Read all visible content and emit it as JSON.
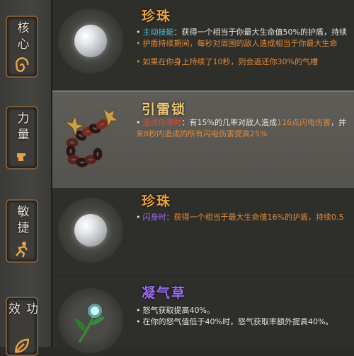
{
  "sidebar": {
    "tabs": [
      {
        "label": "核心",
        "icon": "spiral-icon"
      },
      {
        "label": "力量",
        "icon": "fist-icon"
      },
      {
        "label": "敏捷",
        "icon": "running-figure-icon"
      },
      {
        "label": "功效",
        "icon": "leaf-icon"
      }
    ]
  },
  "items": [
    {
      "name": "珍珠",
      "icon": "pearl-icon",
      "lines": [
        {
          "parts": [
            {
              "text": "主动技能",
              "color": "cyan"
            },
            {
              "text": "：获得一个相当于你最大生命值50%的护盾，持续",
              "color": "white"
            }
          ]
        },
        {
          "parts": [
            {
              "text": "护盾持续期间，每秒对周围的敌人造成相当于你最大生命",
              "color": "orange"
            }
          ]
        },
        {
          "parts": [
            {
              "text": "如果在你身上持续了10秒，则会返还你30%的气槽",
              "color": "orange"
            }
          ]
        }
      ]
    },
    {
      "name": "引雷锁",
      "icon": "lightning-chain-icon",
      "lines": [
        {
          "parts": [
            {
              "text": "造成伤害时",
              "color": "red"
            },
            {
              "text": "：有15%的几率对敌人造成",
              "color": "white"
            },
            {
              "text": "116点",
              "color": "orange"
            },
            {
              "text": "闪电伤害",
              "color": "orange"
            },
            {
              "text": "，并",
              "color": "white"
            }
          ]
        },
        {
          "parts": [
            {
              "text": "来8秒内造成的所有",
              "color": "orange"
            },
            {
              "text": "闪电伤害",
              "color": "orange"
            },
            {
              "text": "提高25%",
              "color": "orange"
            }
          ]
        }
      ]
    },
    {
      "name": "珍珠",
      "icon": "pearl-icon",
      "lines": [
        {
          "parts": [
            {
              "text": "闪身时",
              "color": "purple"
            },
            {
              "text": "：获得一个相当于最大生命值16%的护盾，持续0.5",
              "color": "orange"
            }
          ]
        }
      ]
    },
    {
      "name": "凝气草",
      "icon": "glowing-herb-icon",
      "lines": [
        {
          "parts": [
            {
              "text": "怒气获取提高40%。",
              "color": "white"
            }
          ]
        },
        {
          "parts": [
            {
              "text": "在你的怒气值低于40%时，怒气获取率额外提高40%。",
              "color": "white"
            }
          ]
        }
      ]
    }
  ],
  "colors": {
    "title": "#e9a43f",
    "title_alt": "#9b6cf0",
    "cyan": "#4fc3d6",
    "orange": "#e08a3a",
    "red": "#d64a3a",
    "purple": "#9a6ae0"
  }
}
